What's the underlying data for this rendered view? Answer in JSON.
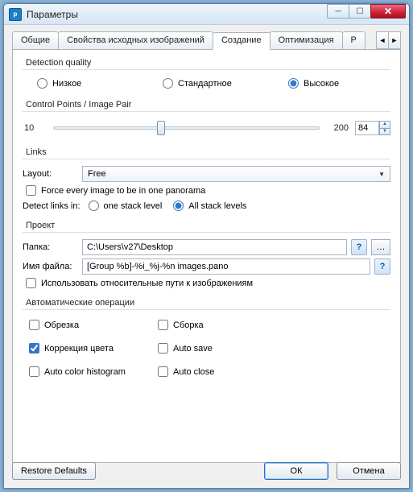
{
  "window": {
    "title": "Параметры"
  },
  "tabs": {
    "t0": "Общие",
    "t1": "Свойства исходных изображений",
    "t2": "Создание",
    "t3": "Оптимизация",
    "t4": "Р"
  },
  "detection": {
    "title": "Detection quality",
    "low": "Низкое",
    "std": "Стандартное",
    "high": "Высокое"
  },
  "cp": {
    "title": "Control Points / Image Pair",
    "min": "10",
    "max": "200",
    "value": "84"
  },
  "links": {
    "title": "Links",
    "layout_lbl": "Layout:",
    "layout_val": "Free",
    "force": "Force every image to be in one panorama",
    "detect_lbl": "Detect links in:",
    "one": "one stack level",
    "all": "All stack levels"
  },
  "project": {
    "title": "Проект",
    "folder_lbl": "Папка:",
    "folder_val": "C:\\Users\\v27\\Desktop",
    "file_lbl": "Имя файла:",
    "file_val": "[Group %b]-%i_%j-%n images.pano",
    "relative": "Использовать относительные пути к изображениям"
  },
  "auto": {
    "title": "Автоматические операции",
    "crop": "Обрезка",
    "assemble": "Сборка",
    "color_corr": "Коррекция цвета",
    "auto_save": "Auto save",
    "hist": "Auto color histogram",
    "auto_close": "Auto close"
  },
  "buttons": {
    "restore": "Restore Defaults",
    "ok": "ОК",
    "cancel": "Отмена"
  }
}
